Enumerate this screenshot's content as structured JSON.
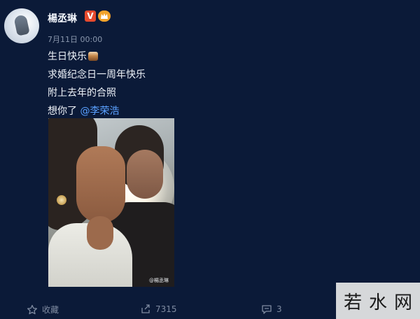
{
  "post": {
    "username": "楊丞琳",
    "verified_badge": "V",
    "timestamp": "7月11日 00:00",
    "lines": [
      "生日快乐",
      "求婚纪念日一周年快乐",
      "附上去年的合照",
      "想你了"
    ],
    "mention": "@李荣浩",
    "photo_watermark": "@楊丞琳"
  },
  "actions": {
    "favorite_label": "收藏",
    "repost_count": "7315",
    "comment_count": "3"
  },
  "site_watermark": {
    "chars": [
      "若",
      "水",
      "网"
    ]
  },
  "icons": {
    "favorite": "star-icon",
    "repost": "repost-icon",
    "comment": "comment-icon"
  }
}
